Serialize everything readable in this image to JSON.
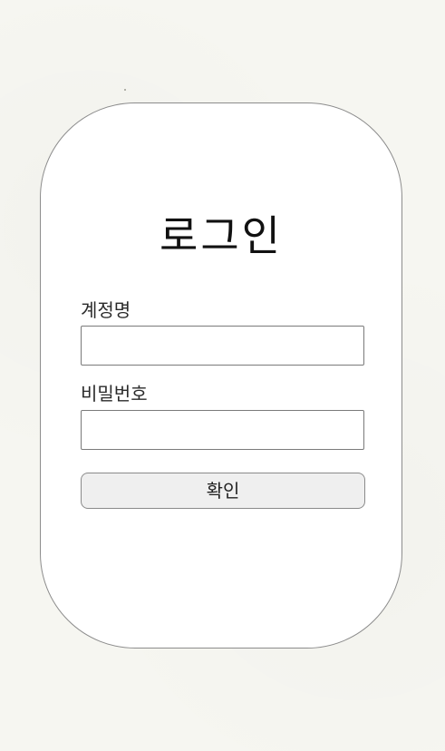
{
  "login": {
    "title": "로그인",
    "account_label": "계정명",
    "account_value": "",
    "password_label": "비밀번호",
    "password_value": "",
    "confirm_label": "확인"
  },
  "colors": {
    "page_background": "#f6f6f1",
    "card_background": "#ffffff",
    "card_border": "#8c8c8c",
    "button_background": "#efefef"
  }
}
